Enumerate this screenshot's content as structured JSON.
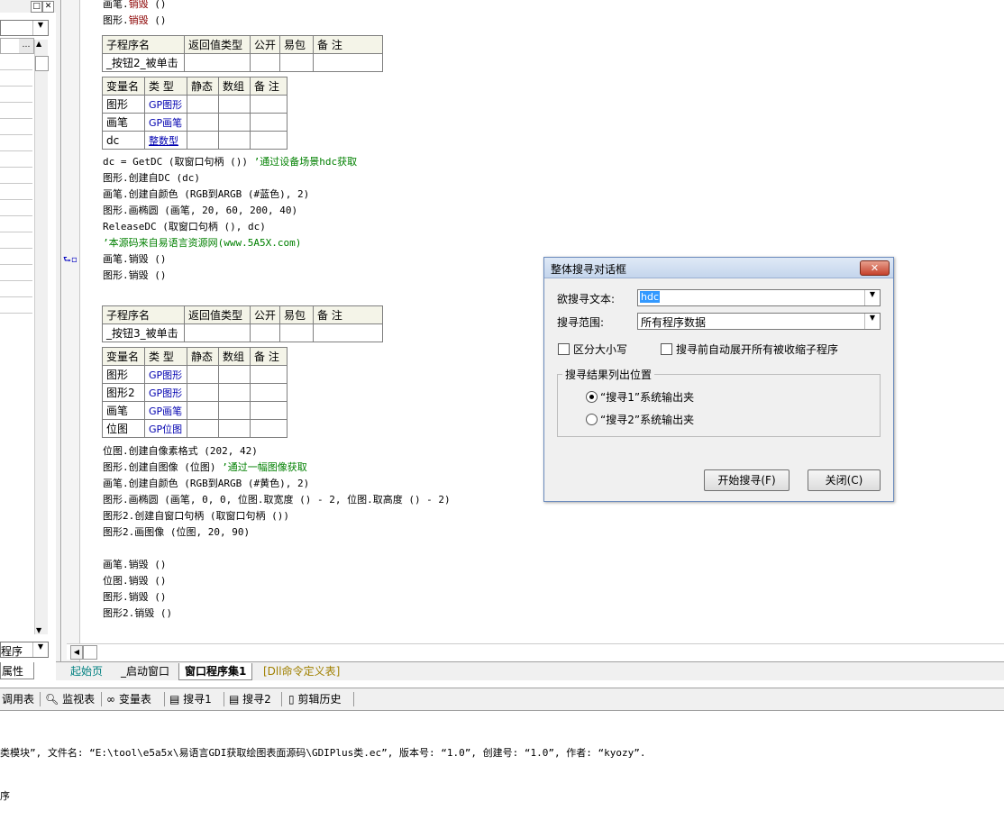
{
  "left_panel": {
    "combo_label": "程序",
    "tab_label": "属性",
    "more_btn": "…"
  },
  "code": {
    "top_lines": [
      {
        "obj": "画笔",
        "method": "销毁",
        "args": " ()"
      },
      {
        "obj": "图形",
        "method": "销毁",
        "args": " ()"
      }
    ],
    "sub2": {
      "headers": [
        "子程序名",
        "返回值类型",
        "公开",
        "易包",
        "备 注"
      ],
      "name": "_按钮2_被单击",
      "var_headers": [
        "变量名",
        "类 型",
        "静态",
        "数组",
        "备 注"
      ],
      "vars": [
        {
          "name": "图形",
          "type": "GP图形"
        },
        {
          "name": "画笔",
          "type": "GP画笔"
        },
        {
          "name": "dc",
          "type": "整数型"
        }
      ],
      "lines": [
        "dc = GetDC (取窗口句柄 ()) ",
        "图形.创建自DC (dc)",
        "画笔.创建自颜色 (RGB到ARGB (#蓝色), 2)",
        "图形.画椭圆 (画笔, 20, 60, 200, 40)",
        "ReleaseDC (取窗口句柄 (), dc)",
        "",
        "画笔.销毁 ()",
        "图形.销毁 ()"
      ],
      "comment1": "’通过设备场景hdc获取",
      "comment2": "’本源码来自易语言资源网(www.5A5X.com)"
    },
    "sub3": {
      "name": "_按钮3_被单击",
      "vars": [
        {
          "name": "图形",
          "type": "GP图形"
        },
        {
          "name": "图形2",
          "type": "GP图形"
        },
        {
          "name": "画笔",
          "type": "GP画笔"
        },
        {
          "name": "位图",
          "type": "GP位图"
        }
      ],
      "lines": [
        "位图.创建自像素格式 (202, 42)",
        "图形.创建自图像 (位图) ",
        "画笔.创建自颜色 (RGB到ARGB (#黄色), 2)",
        "图形.画椭圆 (画笔, 0, 0, 位图.取宽度 () - 2, 位图.取高度 () - 2)",
        "图形2.创建自窗口句柄 (取窗口句柄 ())",
        "图形2.画图像 (位图, 20, 90)",
        "",
        "画笔.销毁 ()",
        "位图.销毁 ()",
        "图形.销毁 ()",
        "图形2.销毁 ()"
      ],
      "comment1": "’通过一幅图像获取"
    }
  },
  "tabs": [
    "起始页",
    "_启动窗口",
    "窗口程序集1",
    "[Dll命令定义表]"
  ],
  "toolbar": [
    "调用表",
    "监视表",
    "变量表",
    "搜寻1",
    "搜寻2",
    "剪辑历史"
  ],
  "output": {
    "line1": "类模块”, 文件名: “E:\\tool\\e5a5x\\易语言GDI获取绘图表面源码\\GDIPlus类.ec”, 版本号: “1.0”, 创建号: “1.0”, 作者: “kyozy”.",
    "line2": "序"
  },
  "dialog": {
    "title": "整体搜寻对话框",
    "close_glyph": "✕",
    "search_label": "欲搜寻文本:",
    "search_value": "hdc",
    "scope_label": "搜寻范围:",
    "scope_value": "所有程序数据",
    "case_label": "区分大小写",
    "expand_label": "搜寻前自动展开所有被收缩子程序",
    "group_label": "搜寻结果列出位置",
    "radio1": "“搜寻1”系统输出夹",
    "radio2": "“搜寻2”系统输出夹",
    "start_btn": "开始搜寻(F)",
    "close_btn": "关闭(C)"
  }
}
